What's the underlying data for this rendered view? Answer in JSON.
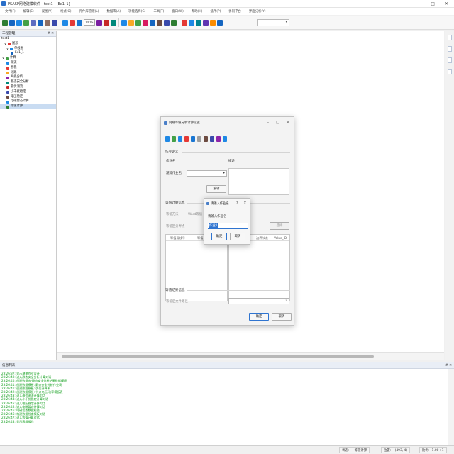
{
  "window": {
    "title": "PSASP网络建模软件 - test1 - [Ex1_1]",
    "buttons": [
      "–",
      "□",
      "✕"
    ]
  },
  "menubar": [
    "文件(F)",
    "编辑(E)",
    "视图(V)",
    "格式(O)",
    "元件库管理(L)",
    "数据库(A)",
    "功能选择(G)",
    "工具(T)",
    "窗口(W)",
    "帮助(H)",
    "插件(P)",
    "协同平台",
    "界面分析(Y)"
  ],
  "toolbar": {
    "zoom_value": "100%",
    "colors": [
      "#2e7d32",
      "#1565c0",
      "#1e88e5",
      "#43a047",
      "#5c6bc0",
      "#1565c0",
      "#8d6e63",
      "#3949ab",
      "#1e88e5",
      "#e53935",
      "#1976d2",
      "#7b1fa2",
      "#c62828",
      "#00897b",
      "#1e88e5",
      "#f9a825",
      "#43a047",
      "#d81b60",
      "#1565c0",
      "#6d4c41",
      "#3949ab",
      "#2e7d32",
      "#e53935",
      "#1e88e5",
      "#00838f",
      "#5e35b1",
      "#fb8c00",
      "#1565c0"
    ]
  },
  "project_panel": {
    "header": "工程管理",
    "header_pin": "# ✕",
    "root": "test1",
    "items": [
      {
        "label": "图形",
        "indent": 2,
        "toggle": "∨",
        "color": "#e53935"
      },
      {
        "label": "单线图",
        "indent": 3,
        "toggle": "∨",
        "color": "#1e88e5"
      },
      {
        "label": "Ex1_1",
        "indent": 5,
        "toggle": "",
        "color": "#1565c0"
      },
      {
        "label": "计算",
        "indent": 1,
        "toggle": "∨",
        "color": "#43a047"
      },
      {
        "label": "潮流",
        "indent": 3,
        "toggle": "",
        "color": "#1e88e5"
      },
      {
        "label": "暂稳",
        "indent": 3,
        "toggle": "",
        "color": "#e53935"
      },
      {
        "label": "短路",
        "indent": 3,
        "toggle": "",
        "color": "#f9a825"
      },
      {
        "label": "网损分析",
        "indent": 3,
        "toggle": "",
        "color": "#8e24aa"
      },
      {
        "label": "静态安全分析",
        "indent": 3,
        "toggle": "",
        "color": "#00897b"
      },
      {
        "label": "最优潮流",
        "indent": 3,
        "toggle": "",
        "color": "#c62828"
      },
      {
        "label": "小干扰稳定",
        "indent": 3,
        "toggle": "",
        "color": "#3949ab"
      },
      {
        "label": "电压稳定",
        "indent": 3,
        "toggle": "",
        "color": "#6d4c41"
      },
      {
        "label": "电磁暂态计算",
        "indent": 3,
        "toggle": "",
        "color": "#1e88e5"
      },
      {
        "label": "等值计算",
        "indent": 3,
        "toggle": "",
        "color": "#2e7d32",
        "selected": true
      }
    ]
  },
  "dialog": {
    "title": "网络等值分析计算设置",
    "buttons": [
      "–",
      "□",
      "✕"
    ],
    "tool_colors": [
      "#1e88e5",
      "#43a047",
      "#1e88e5",
      "#e53935",
      "#1976d2",
      "#9e9e9e",
      "#6d4c41",
      "#3949ab",
      "#8e24aa",
      "#1e88e5"
    ],
    "job_section": "作业定义",
    "job_name_label": "作业名",
    "description_label": "描述",
    "flow_job_label": "潮流作业名:",
    "edit_button": "编辑",
    "equiv_section": "等值计算信息",
    "equiv_method_label": "等值方法:",
    "equiv_method_value": "Ward等值",
    "boundary_label": "等值区分界点",
    "select_button": "选择",
    "table_left_headers": [
      "等值母线号",
      "等值母线名"
    ],
    "table_right_headers": [
      "边界节点",
      "Volue_ID"
    ],
    "result_section": "等值结果信息",
    "result_label": "等值后文件路径",
    "ok_button": "确定",
    "cancel_button": "取消"
  },
  "input_dialog": {
    "title": "请输入作业名",
    "help": "?",
    "close": "X",
    "prompt": "请输入作业名",
    "value": "作业1",
    "ok_button": "确定",
    "cancel_button": "取消"
  },
  "info_panel": {
    "header": "信息列表",
    "header_pin": "# ✕",
    "lines": [
      "23:26:37: 显示潮流作业设计",
      "23:26:40: 进入静态安全分析计算对话",
      "23:26:40: 创建数据库-静态安全分析结果数据模板",
      "23:26:41: 创建数据模板: 静态安全分析作业表",
      "23:26:41: 创建数据模板: 优化计算表",
      "23:26:42: 创建数据模板: 节点电压/功率模板表",
      "23:26:43: 进入最优潮流计算对话",
      "23:26:44: 进入小干扰稳定计算对话",
      "23:26:45: 进入电压稳定计算对话",
      "23:26:45: 进入电磁暂态计算对话",
      "23:26:46: 电磁暂态数据检查",
      "23:26:46: 构建数据检查模板对话",
      "23:26:47: 进入等值计算对话",
      "23:26:48: 显示表格操作"
    ]
  },
  "statusbar": {
    "state_label": "状态:",
    "state_value": "等值计算",
    "position_label": "位置:",
    "position_value": "(493, 4)",
    "scale_label": "比例:",
    "scale_value": "1.00 : 1"
  }
}
